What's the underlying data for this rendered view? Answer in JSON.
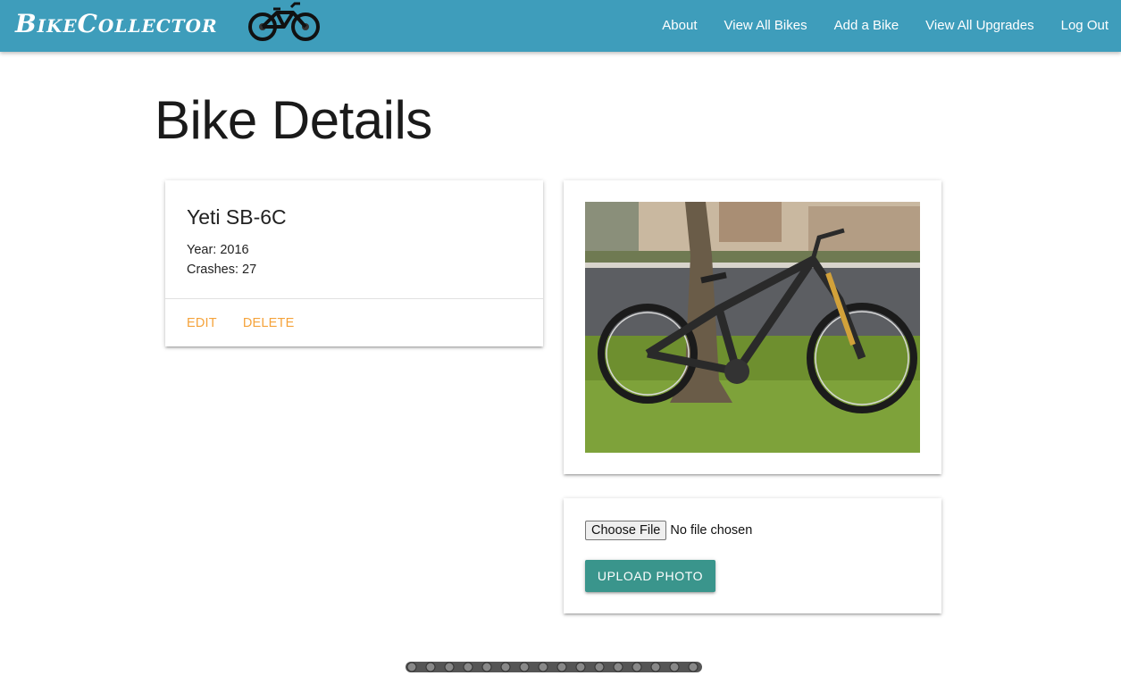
{
  "navbar": {
    "brand": "BikeCollector",
    "brand_icon": "mountain-bike-icon",
    "links": [
      "About",
      "View All Bikes",
      "Add a Bike",
      "View All Upgrades",
      "Log Out"
    ]
  },
  "page": {
    "title": "Bike Details"
  },
  "bike": {
    "name": "Yeti SB-6C",
    "year_line": "Year: 2016",
    "crashes_line": "Crashes: 27",
    "actions": [
      "EDIT",
      "DELETE"
    ]
  },
  "photo": {
    "description_icon": "bike-photo"
  },
  "upload": {
    "choose_label": "Choose File",
    "file_status": "No file chosen",
    "button_label": "UPLOAD PHOTO"
  },
  "footer": {
    "decoration_icon": "bike-chain-icon"
  },
  "colors": {
    "navbar": "#3e9dbb",
    "action": "#f5a33b",
    "upload_button": "#3a958c"
  }
}
